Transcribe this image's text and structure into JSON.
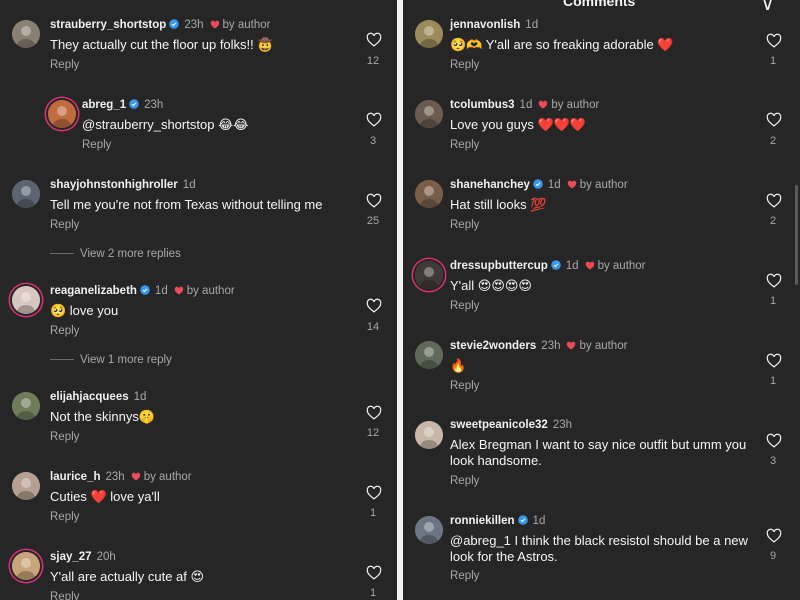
{
  "left": {
    "comments": [
      {
        "username": "strauberry_shortstop",
        "verified": true,
        "time": "23h",
        "by_author": true,
        "by_author_label": "by author",
        "text": "They actually cut the floor up folks!! 🤠",
        "reply_label": "Reply",
        "likes": "12"
      },
      {
        "username": "abreg_1",
        "verified": true,
        "time": "23h",
        "by_author": false,
        "text": "@strauberry_shortstop 😂😂",
        "reply_label": "Reply",
        "likes": "3"
      },
      {
        "username": "shayjohnstonhighroller",
        "verified": false,
        "time": "1d",
        "by_author": false,
        "text": "Tell me you're not from Texas without telling me",
        "reply_label": "Reply",
        "likes": "25"
      },
      {
        "username": "reaganelizabeth",
        "verified": true,
        "time": "1d",
        "by_author": true,
        "by_author_label": "by author",
        "text": "🥺 love you",
        "reply_label": "Reply",
        "likes": "14"
      },
      {
        "username": "elijahjacquees",
        "verified": false,
        "time": "1d",
        "by_author": false,
        "text": "Not the skinnys🤫",
        "reply_label": "Reply",
        "likes": "12"
      },
      {
        "username": "laurice_h",
        "verified": false,
        "time": "23h",
        "by_author": true,
        "by_author_label": "by author",
        "text": "Cuties ❤️ love ya'll",
        "reply_label": "Reply",
        "likes": "1"
      },
      {
        "username": "sjay_27",
        "verified": false,
        "time": "20h",
        "by_author": false,
        "text": "Y'all are actually cute af 😍",
        "reply_label": "Reply",
        "likes": "1"
      }
    ],
    "view_more": [
      "View 2 more replies",
      "View 1 more reply"
    ]
  },
  "right": {
    "header_title": "Comments",
    "comments": [
      {
        "username": "jennavonlish",
        "verified": false,
        "time": "1d",
        "by_author": false,
        "text": "🥺🫶 Y'all are so freaking adorable ❤️",
        "reply_label": "Reply",
        "likes": "1"
      },
      {
        "username": "tcolumbus3",
        "verified": false,
        "time": "1d",
        "by_author": true,
        "by_author_label": "by author",
        "text": "Love you guys ❤️❤️❤️",
        "reply_label": "Reply",
        "likes": "2"
      },
      {
        "username": "shanehanchey",
        "verified": true,
        "time": "1d",
        "by_author": true,
        "by_author_label": "by author",
        "text": "Hat still looks 💯",
        "reply_label": "Reply",
        "likes": "2"
      },
      {
        "username": "dressupbuttercup",
        "verified": true,
        "time": "1d",
        "by_author": true,
        "by_author_label": "by author",
        "text": "Y'all 😍😍😍😍",
        "reply_label": "Reply",
        "likes": "1"
      },
      {
        "username": "stevie2wonders",
        "verified": false,
        "time": "23h",
        "by_author": true,
        "by_author_label": "by author",
        "text": "🔥",
        "reply_label": "Reply",
        "likes": "1"
      },
      {
        "username": "sweetpeanicole32",
        "verified": false,
        "time": "23h",
        "by_author": false,
        "text": "Alex Bregman I want to say nice outfit but umm you look handsome.",
        "reply_label": "Reply",
        "likes": "3"
      },
      {
        "username": "ronniekillen",
        "verified": true,
        "time": "1d",
        "by_author": false,
        "text": "@abreg_1 I think the black resistol should be a new look for the Astros.",
        "reply_label": "Reply",
        "likes": "9"
      }
    ]
  },
  "colors": {
    "background": "#262626",
    "heart_red": "#ed4956",
    "verified_blue": "#3897f0",
    "muted": "#a8a8a8",
    "story_ring": "#d93175"
  },
  "icons": {
    "like": "heart-outline-icon",
    "verified": "verified-badge-icon",
    "author_like": "heart-filled-icon"
  }
}
